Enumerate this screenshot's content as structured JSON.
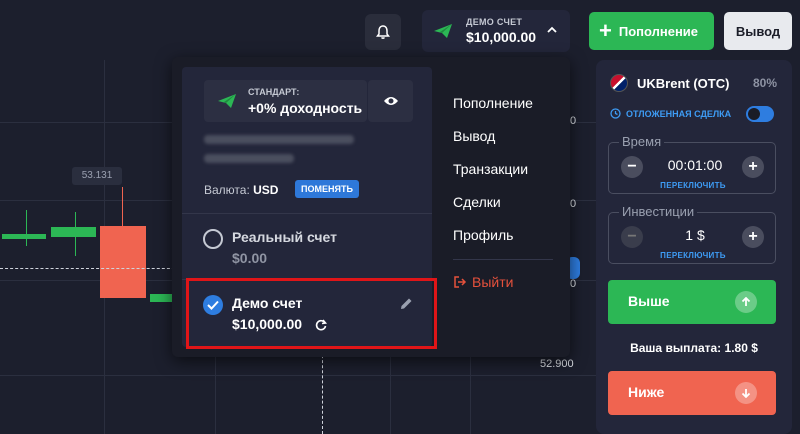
{
  "chart": {
    "price_tag": "53.131",
    "axis_labels": [
      "0",
      "0",
      "0",
      "52.900"
    ]
  },
  "topbar": {
    "account_type": "ДЕМО СЧЕТ",
    "account_balance": "$10,000.00",
    "deposit_label": "Пополнение",
    "withdraw_label": "Вывод"
  },
  "dropdown": {
    "standard_label": "СТАНДАРТ:",
    "standard_value": "+0% доходность",
    "currency_label": "Валюта:",
    "currency_value": "USD",
    "change_label": "ПОМЕНЯТЬ",
    "real_account": {
      "label": "Реальный счет",
      "balance": "$0.00"
    },
    "demo_account": {
      "label": "Демо счет",
      "balance": "$10,000.00"
    },
    "menu": [
      "Пополнение",
      "Вывод",
      "Транзакции",
      "Сделки",
      "Профиль"
    ],
    "logout_label": "Выйти"
  },
  "panel": {
    "asset_name": "UKBrent (OTC)",
    "asset_payout_pct": "80%",
    "pending_label": "ОТЛОЖЕННАЯ СДЕЛКА",
    "time": {
      "title": "Время",
      "value": "00:01:00",
      "switch": "ПЕРЕКЛЮЧИТЬ"
    },
    "investment": {
      "title": "Инвестиции",
      "value": "1 $",
      "switch": "ПЕРЕКЛЮЧИТЬ"
    },
    "up_label": "Выше",
    "down_label": "Ниже",
    "payout_label": "Ваша выплата:",
    "payout_value": "1.80 $"
  },
  "colors": {
    "green": "#2cb755",
    "red": "#f06450",
    "blue": "#2e7de0",
    "highlight": "#e01518"
  }
}
